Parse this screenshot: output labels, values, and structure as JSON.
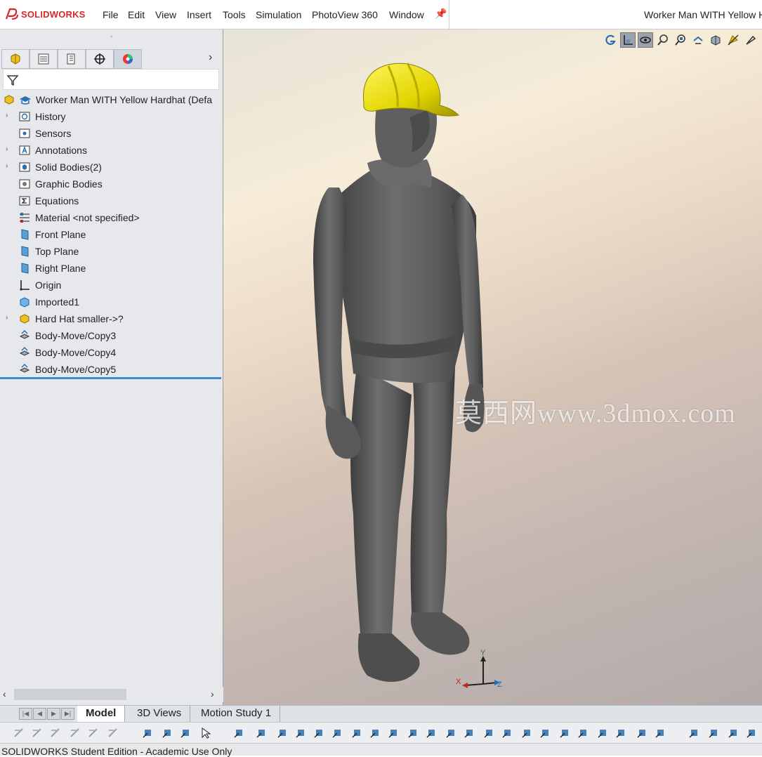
{
  "app": {
    "brand": "SOLIDWORKS",
    "window_title": "Worker Man WITH Yellow H"
  },
  "menu": [
    "File",
    "Edit",
    "View",
    "Insert",
    "Tools",
    "Simulation",
    "PhotoView 360",
    "Window"
  ],
  "feature_tree": {
    "root": "Worker Man WITH Yellow Hardhat (Defa",
    "items": [
      {
        "label": "History",
        "icon": "history-folder-icon",
        "expandable": true
      },
      {
        "label": "Sensors",
        "icon": "sensors-folder-icon",
        "expandable": false
      },
      {
        "label": "Annotations",
        "icon": "annotations-folder-icon",
        "expandable": true
      },
      {
        "label": "Solid Bodies(2)",
        "icon": "solid-bodies-folder-icon",
        "expandable": true
      },
      {
        "label": "Graphic Bodies",
        "icon": "graphic-bodies-folder-icon",
        "expandable": false
      },
      {
        "label": "Equations",
        "icon": "equations-folder-icon",
        "expandable": false
      },
      {
        "label": "Material <not specified>",
        "icon": "material-icon",
        "expandable": false
      },
      {
        "label": "Front Plane",
        "icon": "plane-icon",
        "expandable": false
      },
      {
        "label": "Top Plane",
        "icon": "plane-icon",
        "expandable": false
      },
      {
        "label": "Right Plane",
        "icon": "plane-icon",
        "expandable": false
      },
      {
        "label": "Origin",
        "icon": "origin-icon",
        "expandable": false
      },
      {
        "label": "Imported1",
        "icon": "imported-body-icon",
        "expandable": false
      },
      {
        "label": "Hard Hat smaller->?",
        "icon": "part-icon",
        "expandable": true
      },
      {
        "label": "Body-Move/Copy3",
        "icon": "move-copy-icon",
        "expandable": false
      },
      {
        "label": "Body-Move/Copy4",
        "icon": "move-copy-icon",
        "expandable": false
      },
      {
        "label": "Body-Move/Copy5",
        "icon": "move-copy-icon",
        "expandable": false
      }
    ]
  },
  "watermark": "莫西网www.3dmox.com",
  "triad": {
    "x": "X",
    "y": "Y",
    "z": "Z"
  },
  "bottom_tabs": [
    "Model",
    "3D Views",
    "Motion Study 1"
  ],
  "status_bar": "SOLIDWORKS Student Edition - Academic Use Only",
  "colors": {
    "accent": "#3a8bd0",
    "hardhat": "#e8e000",
    "body": "#5c5c5c",
    "brand": "#d7262c"
  }
}
